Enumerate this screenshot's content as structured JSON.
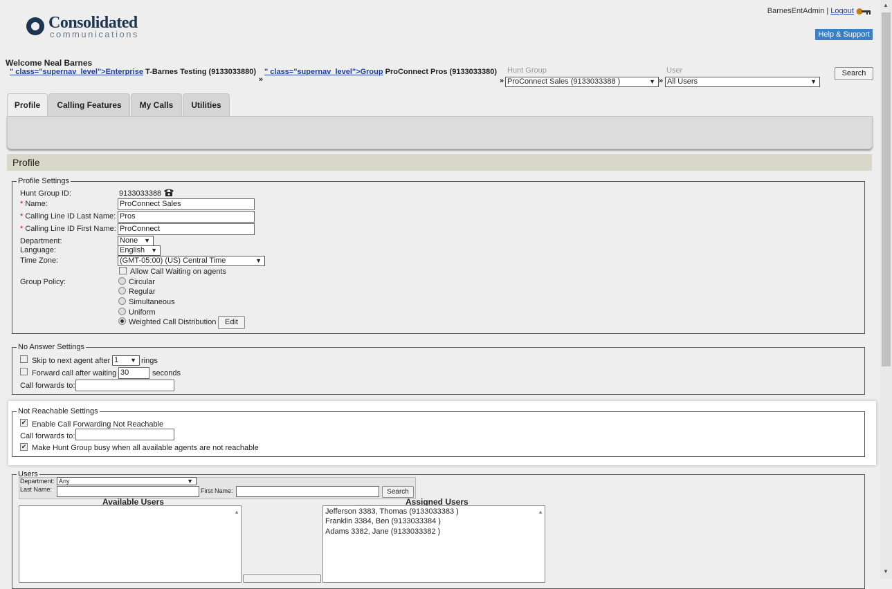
{
  "header": {
    "logo_name": "Consolidated",
    "logo_sub": "communications",
    "user": "BarnesEntAdmin",
    "separator": "|",
    "logout": "Logout",
    "help": "Help & Support",
    "welcome": "Welcome Neal Barnes"
  },
  "breadcrumb": {
    "arrow": "»",
    "enterprise_prefix": "\" class=\"supernav_level\">Enterprise",
    "enterprise_value": "T-Barnes Testing (9133033880)",
    "group_prefix": "\" class=\"supernav_level\">Group",
    "group_value": "ProConnect Pros (9133033380)",
    "hunt_group_label": "Hunt Group",
    "hunt_group_value": "ProConnect Sales (9133033388 )",
    "user_label": "User",
    "user_value": "All Users",
    "search": "Search"
  },
  "tabs": [
    "Profile",
    "Calling Features",
    "My Calls",
    "Utilities"
  ],
  "page_title": "Profile",
  "profile_settings": {
    "legend": "Profile Settings",
    "hunt_group_id_label": "Hunt Group ID:",
    "hunt_group_id": "9133033388",
    "name_label": "Name:",
    "name_value": "ProConnect Sales",
    "clid_last_label": "Calling Line ID Last Name:",
    "clid_last_value": "Pros",
    "clid_first_label": "Calling Line ID First Name:",
    "clid_first_value": "ProConnect",
    "department_label": "Department:",
    "department_value": "None",
    "language_label": "Language:",
    "language_value": "English",
    "timezone_label": "Time Zone:",
    "timezone_value": "(GMT-05:00) (US) Central Time",
    "allow_call_waiting": "Allow Call Waiting on agents",
    "group_policy_label": "Group Policy:",
    "policies": [
      "Circular",
      "Regular",
      "Simultaneous",
      "Uniform",
      "Weighted Call Distribution"
    ],
    "selected_policy": "Weighted Call Distribution",
    "edit": "Edit"
  },
  "no_answer": {
    "legend": "No Answer Settings",
    "skip_label": "Skip to next agent after",
    "skip_value": "1",
    "rings": "rings",
    "forward_label": "Forward call after waiting",
    "forward_value": "30",
    "seconds": "seconds",
    "call_forwards_label": "Call forwards to:"
  },
  "not_reachable": {
    "legend": "Not Reachable Settings",
    "enable_label": "Enable Call Forwarding Not Reachable",
    "call_forwards_label": "Call forwards to:",
    "busy_label": "Make Hunt Group busy when all available agents are not reachable"
  },
  "users": {
    "legend": "Users",
    "department_label": "Department:",
    "department_value": "Any",
    "last_name_label": "Last Name:",
    "first_name_label": "First Name:",
    "search": "Search",
    "available_header": "Available Users",
    "assigned_header": "Assigned Users",
    "assigned": [
      "Jefferson 3383, Thomas (9133033383 )",
      "Franklin 3384, Ben (9133033384 )",
      "Adams 3382, Jane (9133033382 )"
    ]
  },
  "colors": {
    "brand": "#1b3553",
    "link": "#1f3fa0",
    "help_button": "#3c7fc0",
    "profile_bar": "#d8d8c8"
  }
}
